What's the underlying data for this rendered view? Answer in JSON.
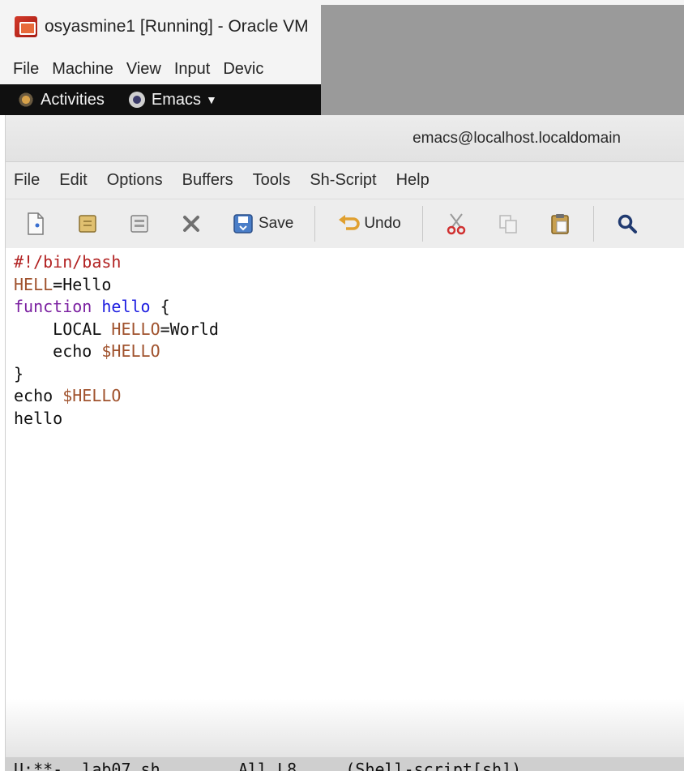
{
  "vbox": {
    "title": "osyasmine1 [Running] - Oracle VM",
    "menu": [
      "File",
      "Machine",
      "View",
      "Input",
      "Devic"
    ]
  },
  "gnome": {
    "activities_label": "Activities",
    "app_label": "Emacs"
  },
  "emacs": {
    "window_title": "emacs@localhost.localdomain",
    "menu": [
      "File",
      "Edit",
      "Options",
      "Buffers",
      "Tools",
      "Sh-Script",
      "Help"
    ],
    "toolbar": {
      "save_label": "Save",
      "undo_label": "Undo"
    },
    "code": [
      {
        "t1": "#!/bin/bash"
      },
      {
        "t1": "HELL",
        "t2": "=Hello"
      },
      {
        "t1": "function",
        "t2": " ",
        "t3": "hello",
        "t4": " {"
      },
      {
        "t1": "    LOCAL ",
        "t2": "HELLO",
        "t3": "=World"
      },
      {
        "t1": "    echo ",
        "t2": "$HELLO"
      },
      {
        "t1": "}"
      },
      {
        "t1": "echo ",
        "t2": "$HELLO"
      },
      {
        "t1": "hello"
      }
    ],
    "mode_line": "U:**-  lab07.sh        All L8     (Shell-script[sh])"
  },
  "colors": {
    "comment": "#b22222",
    "variable": "#a0522d",
    "keyword": "#7a1fa0",
    "function_name": "#1c1ce0"
  }
}
